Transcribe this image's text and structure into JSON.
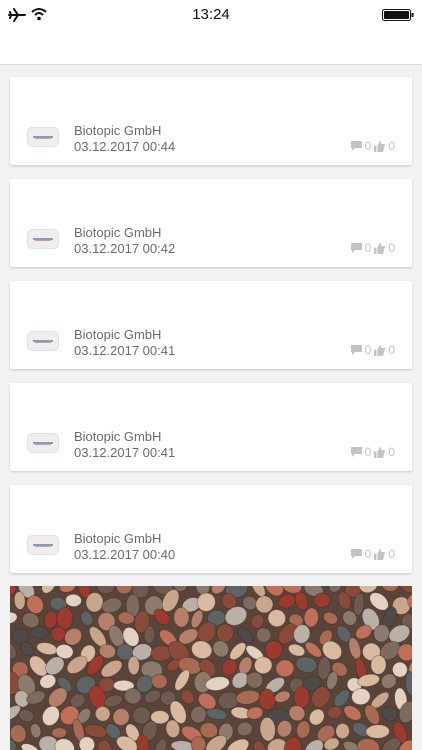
{
  "status_bar": {
    "time": "13:24"
  },
  "posts": [
    {
      "author": "Biotopic GmbH",
      "date": "03.12.2017 00:44",
      "comments": "0",
      "likes": "0"
    },
    {
      "author": "Biotopic GmbH",
      "date": "03.12.2017 00:42",
      "comments": "0",
      "likes": "0"
    },
    {
      "author": "Biotopic GmbH",
      "date": "03.12.2017 00:41",
      "comments": "0",
      "likes": "0"
    },
    {
      "author": "Biotopic GmbH",
      "date": "03.12.2017 00:41",
      "comments": "0",
      "likes": "0"
    },
    {
      "author": "Biotopic GmbH",
      "date": "03.12.2017 00:40",
      "comments": "0",
      "likes": "0"
    }
  ],
  "icons": {
    "status": [
      "airplane-icon",
      "wifi-icon",
      "battery-icon"
    ],
    "post_stats": [
      "comment-icon",
      "thumbs-up-icon"
    ]
  },
  "colors": {
    "background": "#f2f2f2",
    "card": "#ffffff",
    "text": "#6a6a6a",
    "stat_icon": "#c3c3c3"
  }
}
